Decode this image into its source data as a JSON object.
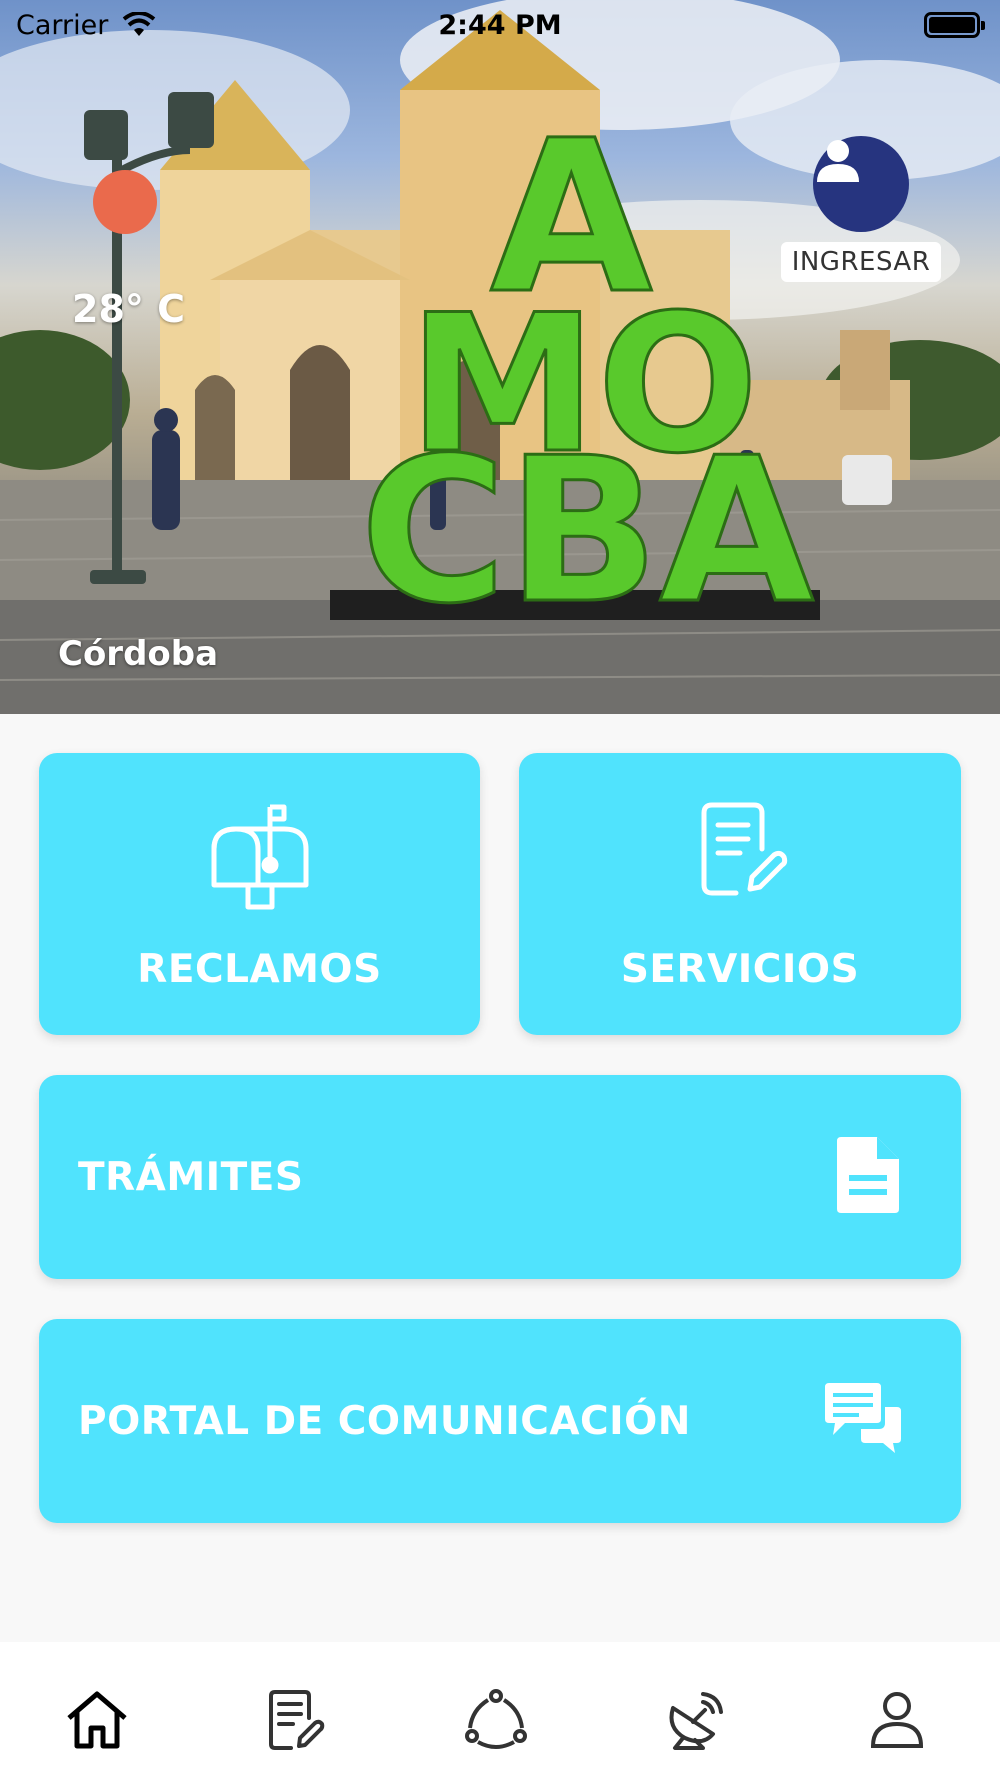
{
  "status_bar": {
    "carrier": "Carrier",
    "time": "2:44 PM"
  },
  "hero": {
    "temperature": "28° C",
    "city": "Córdoba",
    "login_label": "INGRESAR",
    "sculpture_text": [
      "A",
      "MO",
      "CBA"
    ],
    "accent_colors": {
      "weather_dot": "#ea6a4c",
      "avatar": "#26347f",
      "sculpture": "#59c92c"
    }
  },
  "cards": {
    "reclamos": {
      "label": "RECLAMOS",
      "icon": "mailbox-icon"
    },
    "servicios": {
      "label": "SERVICIOS",
      "icon": "document-edit-icon"
    },
    "tramites": {
      "label": "TRÁMITES",
      "icon": "document-icon"
    },
    "portal": {
      "label": "PORTAL DE COMUNICACIÓN",
      "icon": "chat-bubbles-icon"
    },
    "color": "#50e3fd"
  },
  "bottom_nav": {
    "items": [
      {
        "icon": "home-icon",
        "active": true
      },
      {
        "icon": "document-edit-icon",
        "active": false
      },
      {
        "icon": "share-network-icon",
        "active": false
      },
      {
        "icon": "satellite-dish-icon",
        "active": false
      },
      {
        "icon": "user-icon",
        "active": false
      }
    ]
  }
}
